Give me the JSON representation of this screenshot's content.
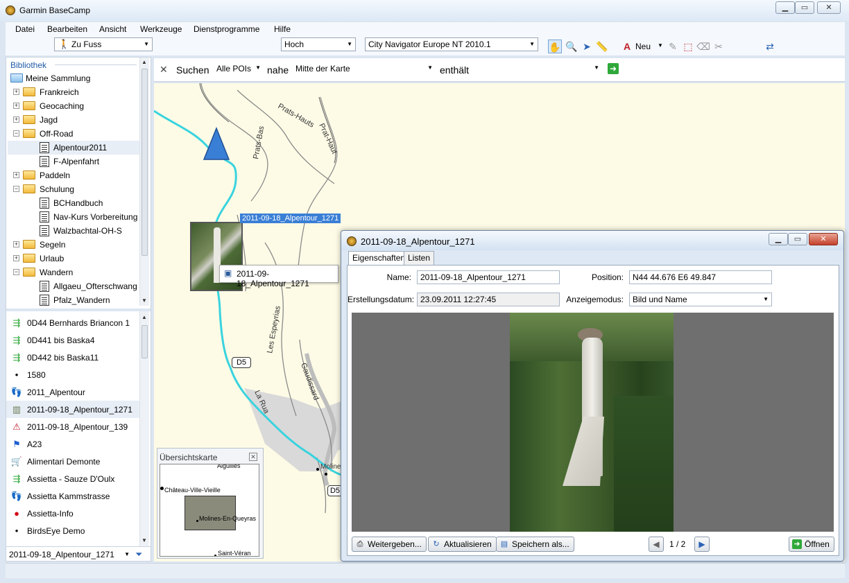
{
  "window": {
    "title": "Garmin BaseCamp",
    "min_icon": "minimize-icon",
    "max_icon": "maximize-icon",
    "close_icon": "close-icon"
  },
  "menu": [
    "Datei",
    "Bearbeiten",
    "Ansicht",
    "Werkzeuge",
    "Dienstprogramme",
    "Hilfe"
  ],
  "toolbar": {
    "profile": "Zu Fuss",
    "detail": "Hoch",
    "map": "City Navigator Europe NT 2010.1",
    "new_label": "Neu"
  },
  "library": {
    "header": "Bibliothek",
    "root": "Meine Sammlung",
    "tree": [
      {
        "label": "Frankreich",
        "type": "folder",
        "level": 1,
        "exp": "+"
      },
      {
        "label": "Geocaching",
        "type": "folder",
        "level": 1,
        "exp": "+"
      },
      {
        "label": "Jagd",
        "type": "folder",
        "level": 1,
        "exp": "+"
      },
      {
        "label": "Off-Road",
        "type": "folder",
        "level": 1,
        "exp": "−"
      },
      {
        "label": "Alpentour2011",
        "type": "doc",
        "level": 2,
        "selected": true
      },
      {
        "label": "F-Alpenfahrt",
        "type": "doc",
        "level": 2
      },
      {
        "label": "Paddeln",
        "type": "folder",
        "level": 1,
        "exp": "+"
      },
      {
        "label": "Schulung",
        "type": "folder",
        "level": 1,
        "exp": "−"
      },
      {
        "label": "BCHandbuch",
        "type": "doc",
        "level": 2
      },
      {
        "label": "Nav-Kurs Vorbereitung",
        "type": "doc",
        "level": 2
      },
      {
        "label": "Walzbachtal-OH-S",
        "type": "doc",
        "level": 2
      },
      {
        "label": "Segeln",
        "type": "folder",
        "level": 1,
        "exp": "+"
      },
      {
        "label": "Urlaub",
        "type": "folder",
        "level": 1,
        "exp": "+"
      },
      {
        "label": "Wandern",
        "type": "folder",
        "level": 1,
        "exp": "−"
      },
      {
        "label": "Allgaeu_Ofterschwang",
        "type": "doc",
        "level": 2
      },
      {
        "label": "Pfalz_Wandern",
        "type": "doc",
        "level": 2
      }
    ],
    "items": [
      {
        "label": "0D44 Bernhards Briancon 1",
        "icon": "route-icon"
      },
      {
        "label": "0D441 bis Baska4",
        "icon": "route-icon"
      },
      {
        "label": "0D442 bis Baska11",
        "icon": "route-icon"
      },
      {
        "label": "1580",
        "icon": "dot-icon"
      },
      {
        "label": "2011_Alpentour",
        "icon": "footprints-icon"
      },
      {
        "label": "2011-09-18_Alpentour_1271",
        "icon": "photo-icon",
        "selected": true
      },
      {
        "label": "2011-09-18_Alpentour_139",
        "icon": "warning-photo-icon"
      },
      {
        "label": "A23",
        "icon": "flag-icon"
      },
      {
        "label": "Alimentari Demonte",
        "icon": "cart-icon"
      },
      {
        "label": "Assietta - Sauze D'Oulx",
        "icon": "route-icon"
      },
      {
        "label": "Assietta Kammstrasse",
        "icon": "footprints-icon"
      },
      {
        "label": "Assietta-Info",
        "icon": "pin-icon"
      },
      {
        "label": "BirdsEye Demo",
        "icon": "dot-icon"
      }
    ],
    "filter_value": "2011-09-18_Alpentour_1271"
  },
  "search": {
    "label": "Suchen",
    "category": "Alle POIs",
    "near_label": "nahe",
    "near_value": "Mitte der Karte",
    "contains_label": "enthält",
    "contains_value": ""
  },
  "map": {
    "roads": [
      "Prats-Bas",
      "Prats-Hauts",
      "Prat-Haut",
      "Les Espeyrias",
      "Gaudissard",
      "La Rua"
    ],
    "road_badge_1": "D5",
    "road_badge_2": "D5",
    "place": "Molines",
    "selected_label": "2011-09-18_Alpentour_1271",
    "photo_popup_label": "2011-09-18_Alpentour_1271"
  },
  "overview": {
    "title": "Übersichtskarte",
    "places": [
      "Aiguilles",
      "Château-Ville-Vieille",
      "Molines-En-Queyras",
      "Saint-Véran"
    ]
  },
  "dialog": {
    "title": "2011-09-18_Alpentour_1271",
    "tabs": [
      "Eigenschaften",
      "Listen"
    ],
    "name_label": "Name:",
    "name_value": "2011-09-18_Alpentour_1271",
    "position_label": "Position:",
    "position_value": "N44 44.676 E6 49.847",
    "created_label": "Erstellungsdatum:",
    "created_value": "23.09.2011 12:27:45",
    "display_label": "Anzeigemodus:",
    "display_value": "Bild und Name",
    "btn_share": "Weitergeben...",
    "btn_refresh": "Aktualisieren",
    "btn_save": "Speichern als...",
    "pager": "1 / 2",
    "btn_open": "Öffnen"
  }
}
